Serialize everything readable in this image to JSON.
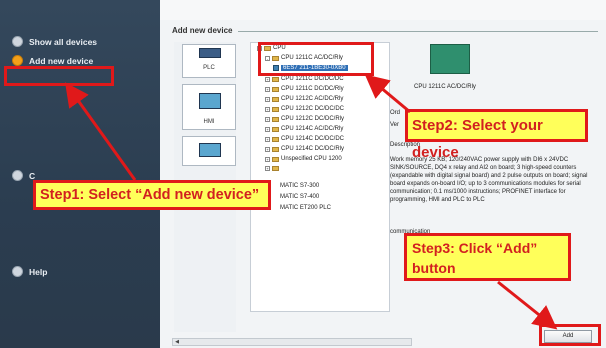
{
  "sidebar": {
    "items": [
      {
        "label": "Show all devices",
        "active": false
      },
      {
        "label": "Add new device",
        "active": true
      },
      {
        "label": "C",
        "active": false
      },
      {
        "label": "Help",
        "active": false
      }
    ]
  },
  "content": {
    "title": "Add new device",
    "categories": [
      "PLC",
      "HMI",
      ""
    ],
    "tree": {
      "root": "CPU",
      "parent": "CPU 1211C AC/DC/Rly",
      "selected": "6ES7 211-1BE30-0XB0",
      "items": [
        "CPU 1211C AC/DC/Rly",
        "CPU 1211C DC/DC/DC",
        "CPU 1211C DC/DC/Rly",
        "CPU 1212C AC/DC/Rly",
        "CPU 1212C DC/DC/DC",
        "CPU 1212C DC/DC/Rly",
        "CPU 1214C AC/DC/Rly",
        "CPU 1214C DC/DC/DC",
        "CPU 1214C DC/DC/Rly",
        "Unspecified CPU 1200"
      ],
      "groups": [
        "MATIC S7-300",
        "MATIC S7-400",
        "MATIC ET200 PLC"
      ]
    },
    "preview_label": "CPU 1211C AC/DC/Rly",
    "info_labels": [
      "Ord",
      "Ver"
    ],
    "description_heading": "Description",
    "description": "Work memory 25 KB; 120/240VAC power supply with DI6 x 24VDC SINK/SOURCE, DQ4 x relay and AI2 on board; 3 high-speed counters (expandable with digital signal board) and 2 pulse outputs on board; signal board expands on-board I/O; up to 3 communications modules for serial communication; 0.1 ms/1000 instructions; PROFINET interface for programming, HMI and PLC to PLC",
    "description_tail": "communication",
    "add_button": "Add"
  },
  "annotations": {
    "step1": "Step1: Select “Add new device”",
    "step2": "Step2: Select your device",
    "step3_line1": "Step3: Click “Add”",
    "step3_line2": "button",
    "accent_color": "#e0191a",
    "callout_fill": "#ffff5a"
  }
}
